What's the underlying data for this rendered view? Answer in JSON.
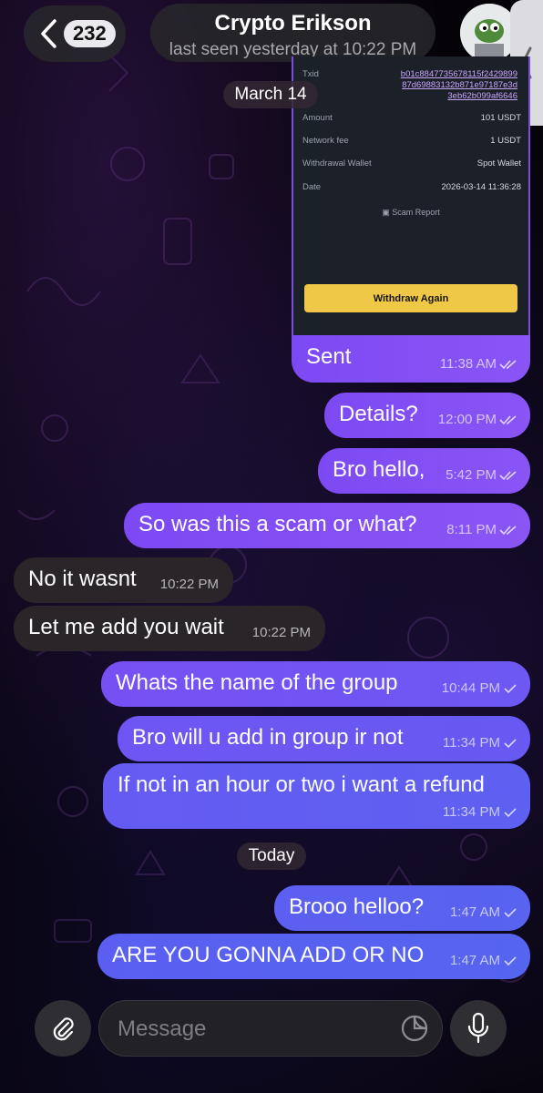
{
  "header": {
    "unread_count": "232",
    "contact_name": "Crypto Erikson",
    "status": "last seen yesterday at 10:22 PM"
  },
  "screenshot_card": {
    "txid_label": "Txid",
    "txid_value": [
      "b01c8847735678115f2429899",
      "87d69883132b871e97187e3d",
      "3eb62b099af6646"
    ],
    "amount_label": "Amount",
    "amount_value": "101 USDT",
    "fee_label": "Network fee",
    "fee_value": "1 USDT",
    "wallet_label": "Withdrawal Wallet",
    "wallet_value": "Spot Wallet",
    "date_label": "Date",
    "date_value": "2026-03-14 11:36:28",
    "scam_report": "Scam Report",
    "withdraw_again": "Withdraw Again"
  },
  "date_separators": [
    "March 14",
    "Today"
  ],
  "messages": [
    {
      "text": "Sent",
      "time": "11:38 AM"
    },
    {
      "text": "Details?",
      "time": "12:00 PM"
    },
    {
      "text": "Bro hello,",
      "time": "5:42 PM"
    },
    {
      "text": "So was this a scam or what?",
      "time": "8:11 PM"
    },
    {
      "text": "No it wasnt",
      "time": "10:22 PM"
    },
    {
      "text": "Let me add you wait",
      "time": "10:22 PM"
    },
    {
      "text": "Whats the name of the group",
      "time": "10:44 PM"
    },
    {
      "text": "Bro will u add in group ir not",
      "time": "11:34 PM"
    },
    {
      "text": "If not in an hour or two i want a refund",
      "time": "11:34 PM"
    },
    {
      "text": "Brooo helloo?",
      "time": "1:47 AM"
    },
    {
      "text": "ARE YOU GONNA ADD OR NO",
      "time": "1:47 AM"
    }
  ],
  "composer": {
    "placeholder": "Message"
  },
  "colors": {
    "outgoing_purple": "#8152f4",
    "outgoing_blue": "#6060f2",
    "incoming": "#2a2529",
    "withdraw_button": "#f0c847"
  }
}
